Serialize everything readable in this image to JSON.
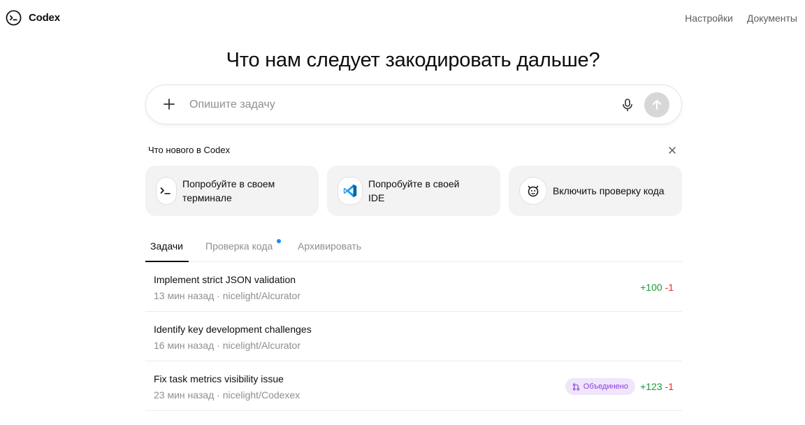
{
  "app": {
    "name": "Codex"
  },
  "nav": {
    "settings": "Настройки",
    "docs": "Документы"
  },
  "hero": {
    "title": "Что нам следует закодировать дальше?"
  },
  "composer": {
    "placeholder": "Опишите задачу",
    "value": ""
  },
  "whats_new": {
    "title": "Что нового в Codex",
    "cards": [
      {
        "label_line1": "Попробуйте в своем",
        "label_line2": "терминале",
        "icon": "terminal-icon"
      },
      {
        "label_line1": "Попробуйте в своей",
        "label_line2": "IDE",
        "icon": "vscode-icon"
      },
      {
        "label_line1": "Включить проверку кода",
        "label_line2": "",
        "icon": "code-review-bot-icon"
      }
    ]
  },
  "tabs": [
    {
      "label": "Задачи",
      "active": true
    },
    {
      "label": "Проверка кода",
      "active": false,
      "dot": true
    },
    {
      "label": "Архивировать",
      "active": false
    }
  ],
  "tasks": [
    {
      "title": "Implement strict JSON validation",
      "meta": "13 мин назад · nicelight/Alcurator",
      "add": "+100",
      "del": "-1",
      "badge": ""
    },
    {
      "title": "Identify key development challenges",
      "meta": "16 мин назад · nicelight/Alcurator",
      "add": "",
      "del": "",
      "badge": ""
    },
    {
      "title": "Fix task metrics visibility issue",
      "meta": "23 мин назад · nicelight/Codexex",
      "add": "+123",
      "del": "-1",
      "badge": "Объединено"
    }
  ],
  "colors": {
    "added": "#1a9a3a",
    "removed": "#e02e2a",
    "accent_dot": "#1a8cff",
    "merged_bg": "#efe6fb",
    "merged_fg": "#8a3fe0"
  }
}
